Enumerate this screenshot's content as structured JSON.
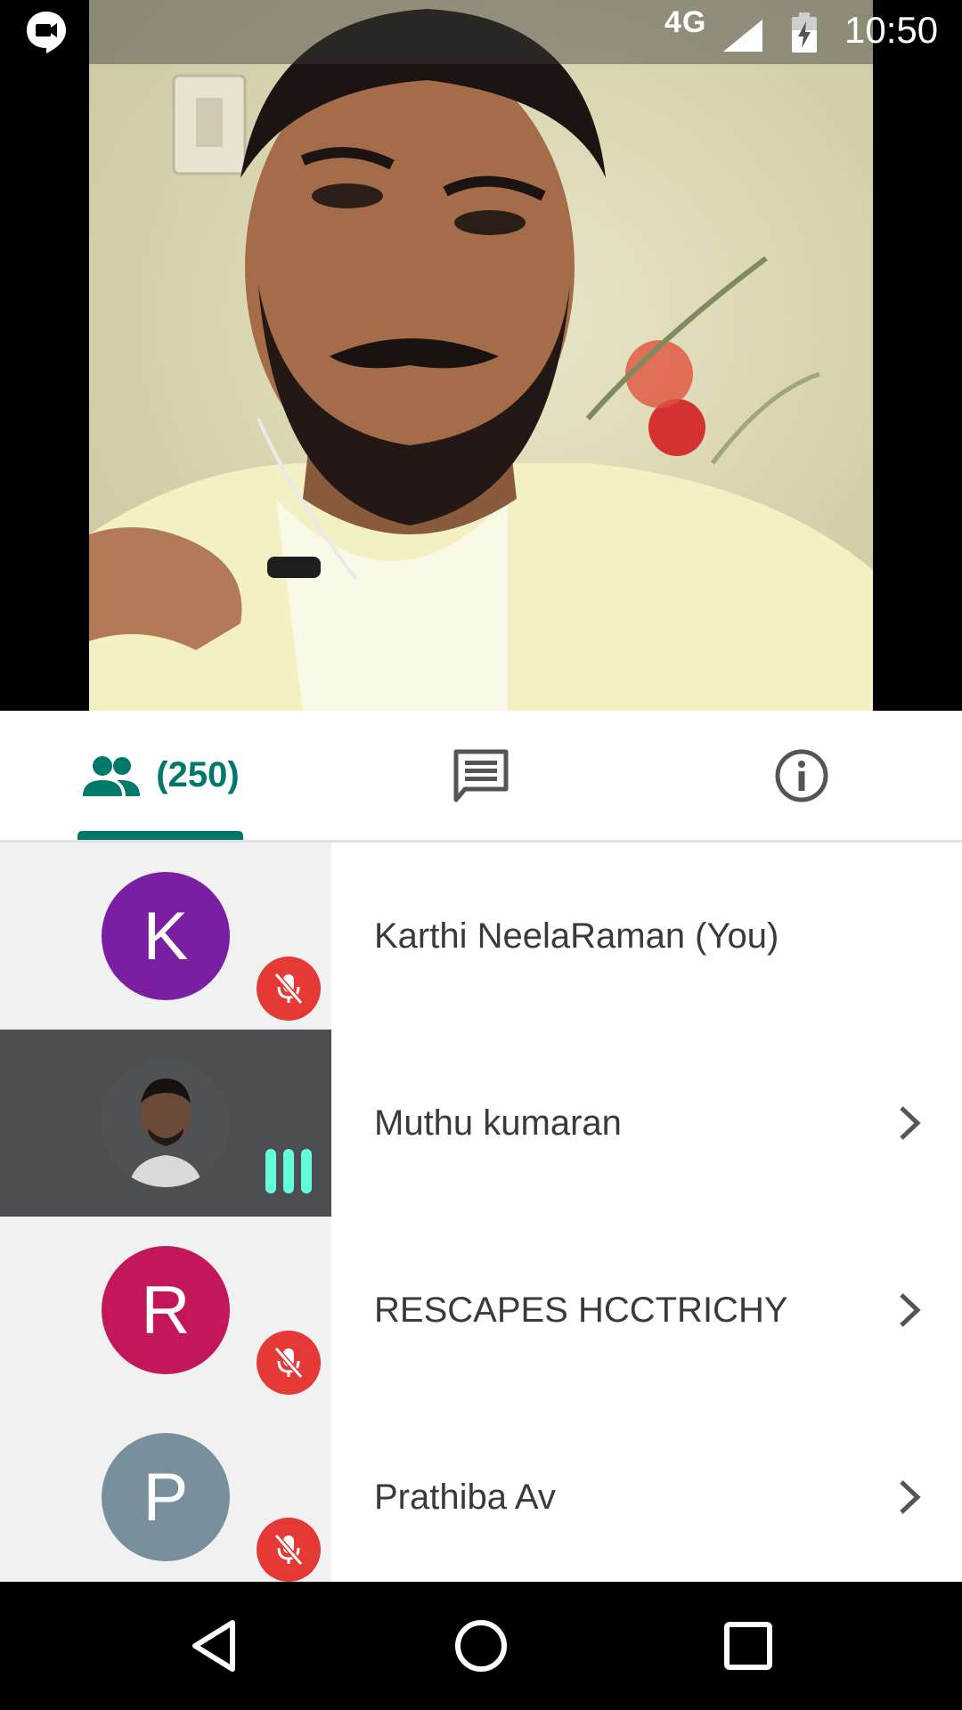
{
  "status_bar": {
    "network": "4G",
    "time": "10:50",
    "icons": [
      "hangouts-video-icon",
      "signal-icon",
      "battery-charging-icon"
    ]
  },
  "video": {
    "content": "live video feed of speaker"
  },
  "tabs": {
    "people_count": "(250)",
    "selected": "people",
    "icons": [
      "people-icon",
      "chat-icon",
      "info-icon"
    ]
  },
  "participants": [
    {
      "initial": "K",
      "name": "Karthi NeelaRaman (You)",
      "avatar_color": "#7b1fa2",
      "muted": true,
      "chevron": false
    },
    {
      "initial": "",
      "name": "Muthu kumaran",
      "avatar_color": "#555659",
      "muted": false,
      "speaking": true,
      "chevron": true
    },
    {
      "initial": "R",
      "name": "RESCAPES HCCTRICHY",
      "avatar_color": "#c2185b",
      "muted": true,
      "chevron": true
    },
    {
      "initial": "P",
      "name": "Prathiba Av",
      "avatar_color": "#78909c",
      "muted": true,
      "chevron": true
    }
  ],
  "colors": {
    "accent": "#00796b",
    "mute": "#e53935",
    "speaking": "#64ffda",
    "active_row": "#4d4e52"
  },
  "nav": {
    "icons": [
      "back-icon",
      "home-icon",
      "recents-icon"
    ]
  }
}
